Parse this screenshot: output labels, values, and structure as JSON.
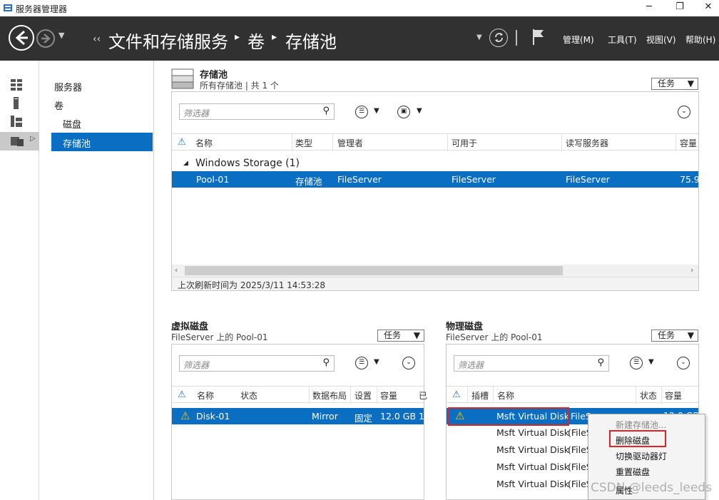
{
  "window": {
    "title": "服务器管理器",
    "minimize": "─",
    "restore": "❐",
    "close": "✕"
  },
  "header": {
    "breadcrumb": [
      "文件和存储服务",
      "卷",
      "存储池"
    ],
    "crumb_prefix": "‹‹",
    "crumb_sep": "▸",
    "menus": {
      "manage": "管理(M)",
      "tools": "工具(T)",
      "view": "视图(V)",
      "help": "帮助(H)"
    }
  },
  "nav": {
    "servers": "服务器",
    "volumes": "卷",
    "disks": "磁盘",
    "pools": "存储池"
  },
  "pools": {
    "title": "存储池",
    "subtitle": "所有存储池 | 共 1 个",
    "task": "任务",
    "filter_placeholder": "筛选器",
    "columns": [
      "名称",
      "类型",
      "管理者",
      "可用于",
      "读写服务器",
      "容量"
    ],
    "group": "Windows Storage (1)",
    "row": {
      "name": "Pool-01",
      "type": "存储池",
      "managed_by": "FileServer",
      "available_to": "FileServer",
      "rw_server": "FileServer",
      "capacity": "75.9"
    },
    "refresh": "上次刷新时间为 2025/3/11 14:53:28"
  },
  "vdisk": {
    "title": "虚拟磁盘",
    "subtitle": "FileServer 上的 Pool-01",
    "task": "任务",
    "filter_placeholder": "筛选器",
    "columns": [
      "名称",
      "状态",
      "数据布局",
      "设置",
      "容量",
      "已"
    ],
    "row": {
      "name": "Disk-01",
      "layout": "Mirror",
      "setting": "固定",
      "capacity": "12.0 GB",
      "extra": "1"
    }
  },
  "pdisk": {
    "title": "物理磁盘",
    "subtitle": "FileServer 上的 Pool-01",
    "task": "任务",
    "filter_placeholder": "筛选器",
    "columns": [
      "插槽",
      "名称",
      "状态",
      "容量"
    ],
    "rows": [
      {
        "name": "Msft Virtual Disk",
        "server": "FileServer"
      },
      {
        "name": "Msft Virtual Disk",
        "server": "(FileS"
      },
      {
        "name": "Msft Virtual Disk",
        "server": "(FileS"
      },
      {
        "name": "Msft Virtual Disk",
        "server": "(FileS"
      },
      {
        "name": "Msft Virtual Disk",
        "server": "(FileS"
      }
    ],
    "first_cap_partial": "12.0 GB"
  },
  "context_menu": [
    "新建存储池...",
    "删除磁盘",
    "切换驱动器灯",
    "重置磁盘",
    "属性"
  ],
  "watermark": "CSDN @leeds_leeds",
  "colors": {
    "header_bg": "#313131",
    "selection": "#0a6fc2",
    "highlight_box": "#e02424"
  }
}
